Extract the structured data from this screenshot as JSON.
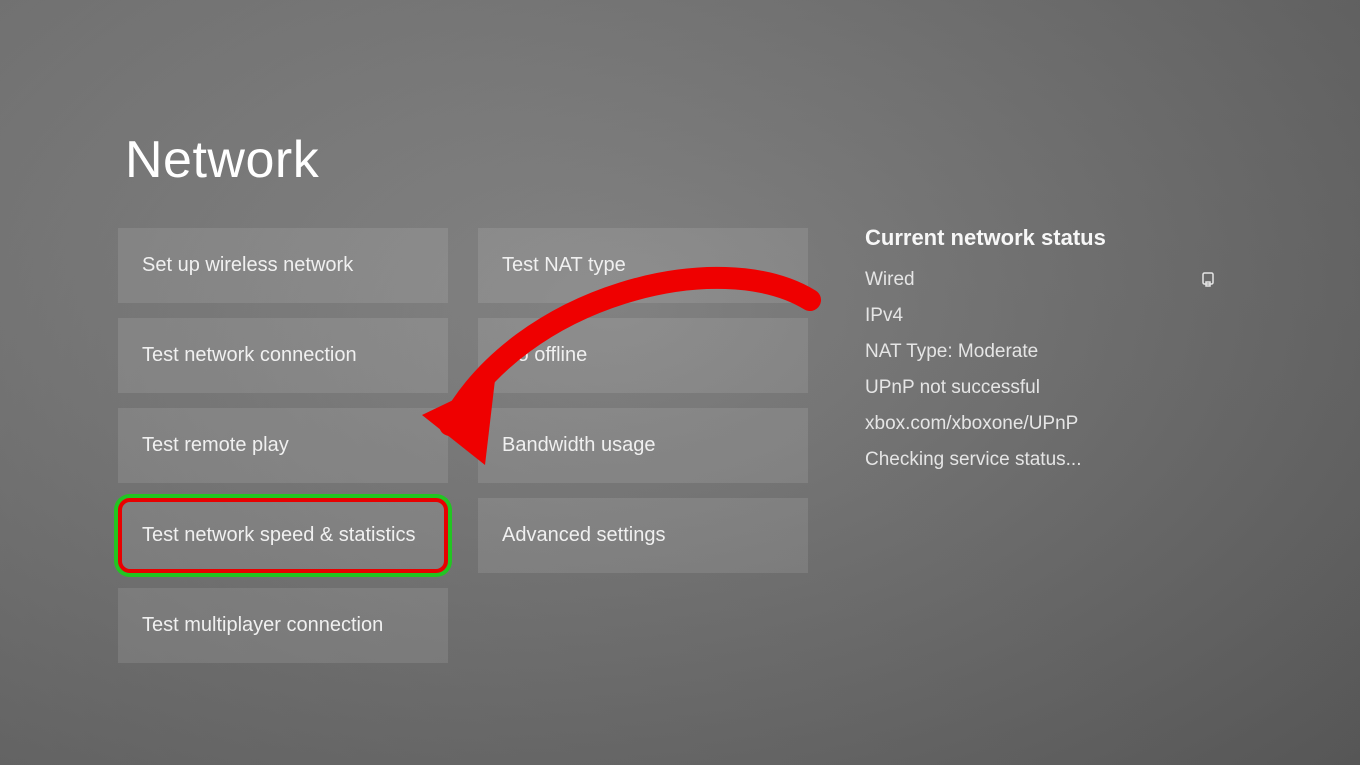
{
  "title": "Network",
  "columns": {
    "left": [
      {
        "id": "setup-wireless",
        "label": "Set up wireless network",
        "highlighted": false
      },
      {
        "id": "test-connection",
        "label": "Test network connection",
        "highlighted": false
      },
      {
        "id": "test-remote-play",
        "label": "Test remote play",
        "highlighted": false
      },
      {
        "id": "test-speed",
        "label": "Test network speed & statistics",
        "highlighted": true
      },
      {
        "id": "test-multiplayer",
        "label": "Test multiplayer connection",
        "highlighted": false
      }
    ],
    "right": [
      {
        "id": "test-nat",
        "label": "Test NAT type",
        "highlighted": false
      },
      {
        "id": "go-offline",
        "label": "Go offline",
        "highlighted": false
      },
      {
        "id": "bandwidth",
        "label": "Bandwidth usage",
        "highlighted": false
      },
      {
        "id": "advanced",
        "label": "Advanced settings",
        "highlighted": false
      }
    ]
  },
  "status": {
    "heading": "Current network status",
    "items": [
      {
        "label": "Wired",
        "icon": "ethernet"
      },
      {
        "label": "IPv4"
      },
      {
        "label": "NAT Type: Moderate"
      },
      {
        "label": "UPnP not successful"
      },
      {
        "label": "xbox.com/xboxone/UPnP"
      },
      {
        "label": "Checking service status..."
      }
    ]
  },
  "annotation": {
    "arrow_color": "#ef0000",
    "highlight_outer": "#22c522",
    "highlight_inner": "#e80000"
  }
}
